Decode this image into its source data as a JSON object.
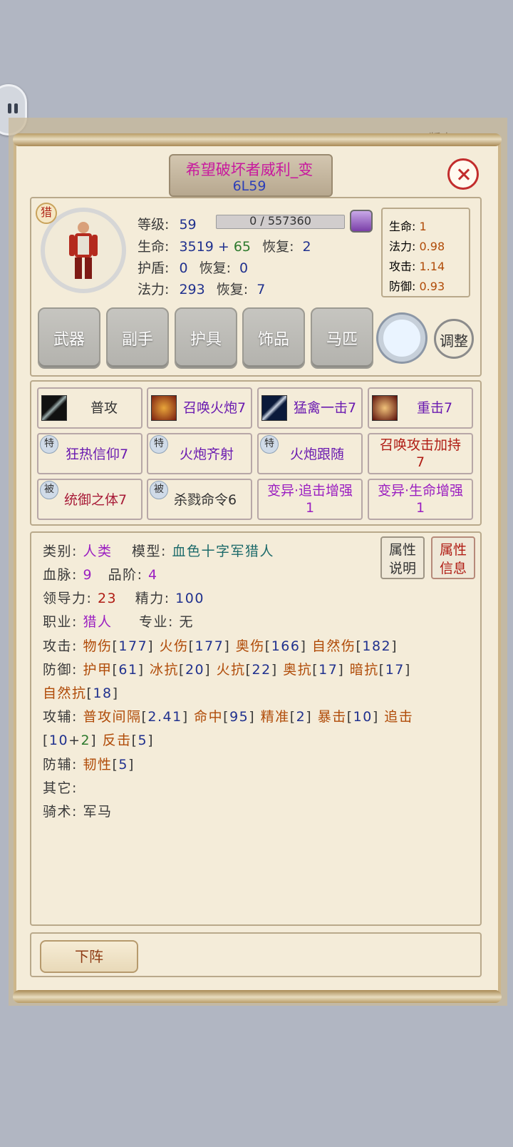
{
  "header": {
    "version": "版本 1.0.0",
    "name": "希望破坏者威利_变",
    "level_code": "6L59"
  },
  "portrait": {
    "class_badge": "猎"
  },
  "basic": {
    "level_label": "等级:",
    "level_value": "59",
    "exp_text": "0 / 557360",
    "hp_label": "生命:",
    "hp_value": "3519",
    "hp_plus": "+",
    "hp_bonus": "65",
    "hp_regen_label": "恢复:",
    "hp_regen": "2",
    "shield_label": "护盾:",
    "shield_value": "0",
    "shield_regen_label": "恢复:",
    "shield_regen": "0",
    "mp_label": "法力:",
    "mp_value": "293",
    "mp_regen_label": "恢复:",
    "mp_regen": "7"
  },
  "growth": [
    {
      "label": "生命:",
      "value": "1"
    },
    {
      "label": "法力:",
      "value": "0.98"
    },
    {
      "label": "攻击:",
      "value": "1.14"
    },
    {
      "label": "防御:",
      "value": "0.93"
    }
  ],
  "equipment_tabs": [
    "武器",
    "副手",
    "护具",
    "饰品",
    "马匹"
  ],
  "adjust_label": "调整",
  "skills": [
    {
      "text": "普攻",
      "badge": ""
    },
    {
      "text": "召唤火炮7",
      "badge": ""
    },
    {
      "text": "猛禽一击7",
      "badge": ""
    },
    {
      "text": "重击7",
      "badge": ""
    },
    {
      "text": "狂热信仰7",
      "badge": "特"
    },
    {
      "text": "火炮齐射",
      "badge": "特"
    },
    {
      "text": "火炮跟随",
      "badge": "特"
    },
    {
      "line1": "召唤攻击加持",
      "line2": "7"
    },
    {
      "text": "统御之体7",
      "badge": "被"
    },
    {
      "text": "杀戮命令6",
      "badge": "被"
    },
    {
      "line1": "变异·追击增强",
      "line2": "1"
    },
    {
      "line1": "变异·生命增强",
      "line2": "1"
    }
  ],
  "attr_buttons": {
    "explain_l1": "属性",
    "explain_l2": "说明",
    "info_l1": "属性",
    "info_l2": "信息"
  },
  "info": {
    "category_label": "类别:",
    "category": "人类",
    "model_label": "模型:",
    "model": "血色十字军猎人",
    "bloodline_label": "血脉:",
    "bloodline": "9",
    "grade_label": "品阶:",
    "grade": "4",
    "leadership_label": "领导力:",
    "leadership": "23",
    "energy_label": "精力:",
    "energy": "100",
    "job_label": "职业:",
    "job": "猎人",
    "spec_label": "专业:",
    "spec": "无",
    "atk_label": "攻击:",
    "atk_physical": "物伤",
    "atk_physical_v": "177",
    "atk_fire": "火伤",
    "atk_fire_v": "177",
    "atk_arcane": "奥伤",
    "atk_arcane_v": "166",
    "atk_nature": "自然伤",
    "atk_nature_v": "182",
    "def_label": "防御:",
    "def_armor": "护甲",
    "def_armor_v": "61",
    "def_frost": "冰抗",
    "def_frost_v": "20",
    "def_fire": "火抗",
    "def_fire_v": "22",
    "def_arcane": "奥抗",
    "def_arcane_v": "17",
    "def_shadow": "暗抗",
    "def_shadow_v": "17",
    "def_nature": "自然抗",
    "def_nature_v": "18",
    "atkaux_label": "攻辅:",
    "aa_interval": "普攻间隔",
    "aa_interval_v": "2.41",
    "aa_hit": "命中",
    "aa_hit_v": "95",
    "aa_precise": "精准",
    "aa_precise_v": "2",
    "aa_crit": "暴击",
    "aa_crit_v": "10",
    "aa_chase": "追击",
    "aa_chase_v1": "10",
    "aa_chase_plus": "+",
    "aa_chase_v2": "2",
    "aa_counter": "反击",
    "aa_counter_v": "5",
    "defaux_label": "防辅:",
    "da_tough": "韧性",
    "da_tough_v": "5",
    "other_label": "其它:",
    "riding_label": "骑术:",
    "riding": "军马"
  },
  "footer": {
    "dismiss_label": "下阵"
  }
}
